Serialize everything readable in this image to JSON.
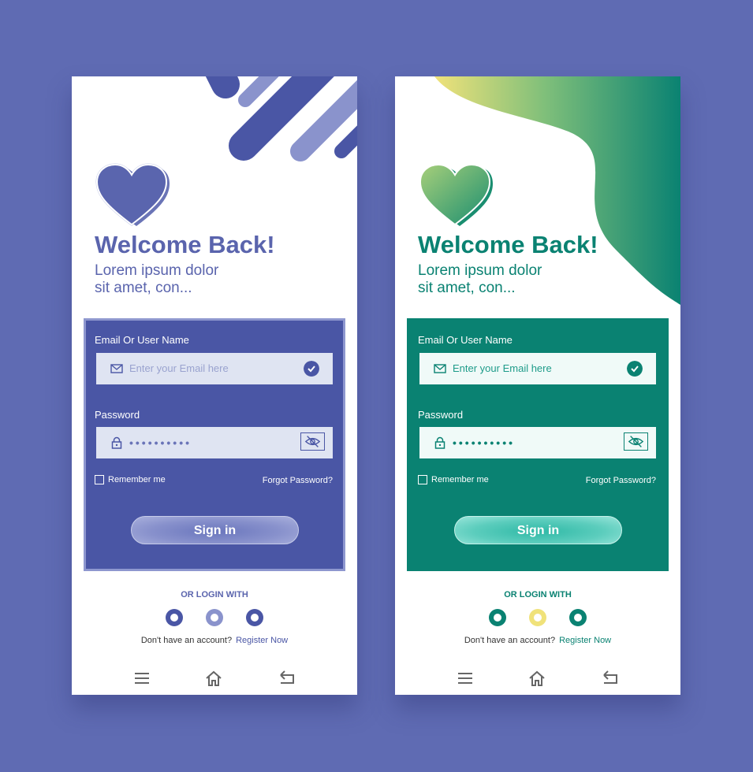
{
  "screens": [
    {
      "id": "blue",
      "colors": {
        "accent": "#4a56a5",
        "text": "#5a64ad"
      },
      "title": "Welcome Back!",
      "subtitle_line1": "Lorem ipsum dolor",
      "subtitle_line2": "sit amet, con...",
      "email_label": "Email Or User Name",
      "email_placeholder": "Enter your Email here",
      "password_label": "Password",
      "password_value": "••••••••••",
      "remember_label": "Remember me",
      "forgot_label": "Forgot Password?",
      "signin_label": "Sign in",
      "or_login_label": "OR LOGIN WITH",
      "no_account_text": "Don't have an account?",
      "register_label": "Register Now"
    },
    {
      "id": "green",
      "colors": {
        "accent": "#0a8272",
        "text": "#0a8272"
      },
      "title": "Welcome Back!",
      "subtitle_line1": "Lorem ipsum dolor",
      "subtitle_line2": "sit amet, con...",
      "email_label": "Email Or User Name",
      "email_placeholder": "Enter your Email here",
      "password_label": "Password",
      "password_value": "••••••••••",
      "remember_label": "Remember me",
      "forgot_label": "Forgot Password?",
      "signin_label": "Sign in",
      "or_login_label": "OR LOGIN WITH",
      "no_account_text": "Don't have an account?",
      "register_label": "Register Now"
    }
  ],
  "icons": {
    "email": "envelope-icon",
    "check": "checkmark-icon",
    "lock": "lock-icon",
    "visibility": "eye-slash-icon",
    "menu": "menu-icon",
    "home": "home-icon",
    "back": "back-icon"
  },
  "background_color": "#5f6bb3"
}
